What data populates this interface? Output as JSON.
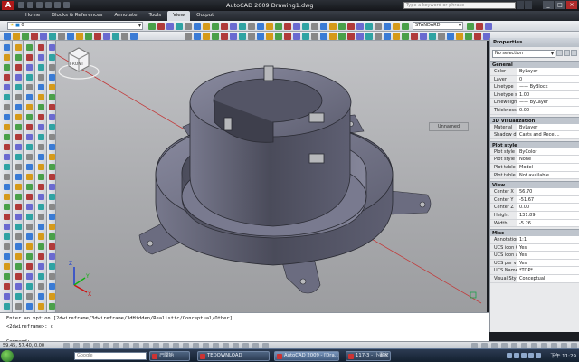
{
  "window": {
    "title": "AutoCAD 2009  Drawing1.dwg",
    "search_placeholder": "Type a keyword or phrase",
    "app_logo_letter": "A"
  },
  "ribbon_tabs": [
    {
      "label": "Home",
      "active": false
    },
    {
      "label": "Blocks & References",
      "active": false
    },
    {
      "label": "Annotate",
      "active": false
    },
    {
      "label": "Tools",
      "active": false
    },
    {
      "label": "View",
      "active": true
    },
    {
      "label": "Output",
      "active": false
    }
  ],
  "toolbar": {
    "layer_value": "0",
    "text_style_value": "STANDARD"
  },
  "viewport": {
    "named_view_label": "Unnamed",
    "viewcube_face": "FRONT",
    "accent_model": "#6e6f83",
    "ucs_colors": {
      "x": "#d01010",
      "y": "#10b010",
      "z": "#2040d0"
    }
  },
  "properties": {
    "title": "Properties",
    "selection": "No selection",
    "sections": [
      {
        "name": "General",
        "rows": [
          {
            "k": "Color",
            "v": "ByLayer"
          },
          {
            "k": "Layer",
            "v": "0"
          },
          {
            "k": "Linetype",
            "v": "—— ByBlock"
          },
          {
            "k": "Linetype sc...",
            "v": "1.00"
          },
          {
            "k": "Lineweight",
            "v": "—— ByLayer"
          },
          {
            "k": "Thickness",
            "v": "0.00"
          }
        ]
      },
      {
        "name": "3D Visualization",
        "rows": [
          {
            "k": "Material",
            "v": "ByLayer"
          },
          {
            "k": "Shadow disp...",
            "v": "Casts and Recei..."
          }
        ]
      },
      {
        "name": "Plot style",
        "rows": [
          {
            "k": "Plot style",
            "v": "ByColor"
          },
          {
            "k": "Plot style ta...",
            "v": "None"
          },
          {
            "k": "Plot table at...",
            "v": "Model"
          },
          {
            "k": "Plot table ty...",
            "v": "Not available"
          }
        ]
      },
      {
        "name": "View",
        "rows": [
          {
            "k": "Center X",
            "v": "56.70"
          },
          {
            "k": "Center Y",
            "v": "-51.67"
          },
          {
            "k": "Center Z",
            "v": "0.00"
          },
          {
            "k": "Height",
            "v": "131.89"
          },
          {
            "k": "Width",
            "v": "-5.26"
          }
        ]
      },
      {
        "name": "Misc",
        "rows": [
          {
            "k": "Annotation s...",
            "v": "1:1"
          },
          {
            "k": "UCS icon On",
            "v": "Yes"
          },
          {
            "k": "UCS icon at ...",
            "v": "Yes"
          },
          {
            "k": "UCS per vie...",
            "v": "Yes"
          },
          {
            "k": "UCS Name",
            "v": "*TOP*"
          },
          {
            "k": "Visual Style",
            "v": "Conceptual"
          }
        ]
      }
    ]
  },
  "command_line": {
    "lines": [
      "Enter an option [2dwireframe/3dwireframe/3dHidden/Realistic/Conceptual/Other]",
      "<2dwireframe>: c",
      "",
      "Command:"
    ]
  },
  "status_bar": {
    "coords": "59.45, 57.40, 0.00"
  },
  "taskbar": {
    "search_label": "Google",
    "tasks": [
      {
        "label": "己開始",
        "active": false
      },
      {
        "label": "TEDOWNLOAD",
        "active": false
      },
      {
        "label": "AutoCAD 2009 - [Dra...",
        "active": true
      },
      {
        "label": "117-3 - 小畫家",
        "active": false
      }
    ],
    "clock": "下午 11:29"
  }
}
